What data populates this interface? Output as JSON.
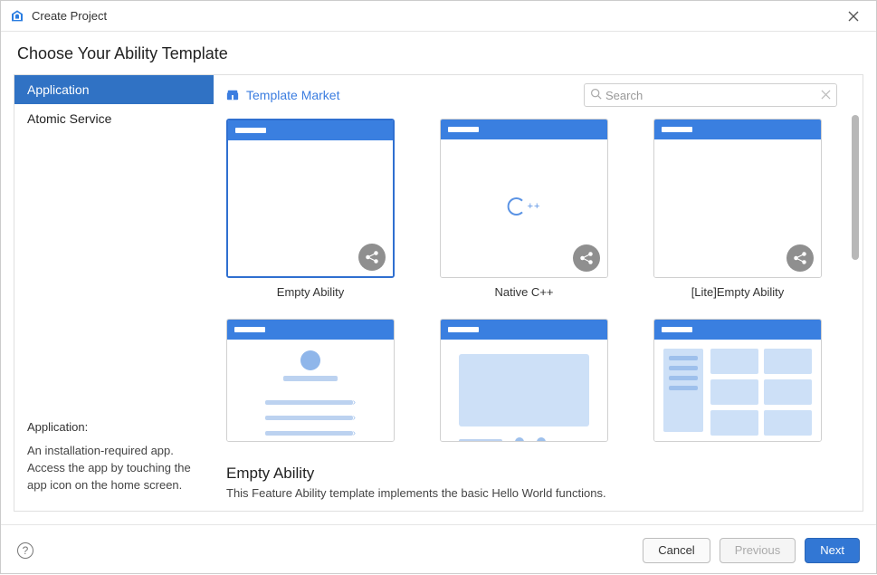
{
  "window": {
    "title": "Create Project"
  },
  "page": {
    "heading": "Choose Your Ability Template"
  },
  "sidebar": {
    "items": [
      {
        "label": "Application",
        "selected": true
      },
      {
        "label": "Atomic Service",
        "selected": false
      }
    ],
    "desc_title": "Application:",
    "desc_text": "An installation-required app. Access the app by touching the app icon on the home screen."
  },
  "header": {
    "market_link": "Template Market",
    "search_placeholder": "Search"
  },
  "templates": [
    {
      "label": "Empty Ability",
      "kind": "empty",
      "selected": true
    },
    {
      "label": "Native C++",
      "kind": "cpp",
      "selected": false
    },
    {
      "label": "[Lite]Empty Ability",
      "kind": "empty",
      "selected": false
    },
    {
      "label": "",
      "kind": "about",
      "selected": false
    },
    {
      "label": "",
      "kind": "category",
      "selected": false
    },
    {
      "label": "",
      "kind": "dashboard",
      "selected": false
    }
  ],
  "detail": {
    "title": "Empty Ability",
    "description": "This Feature Ability template implements the basic Hello World functions."
  },
  "footer": {
    "cancel": "Cancel",
    "previous": "Previous",
    "next": "Next"
  }
}
